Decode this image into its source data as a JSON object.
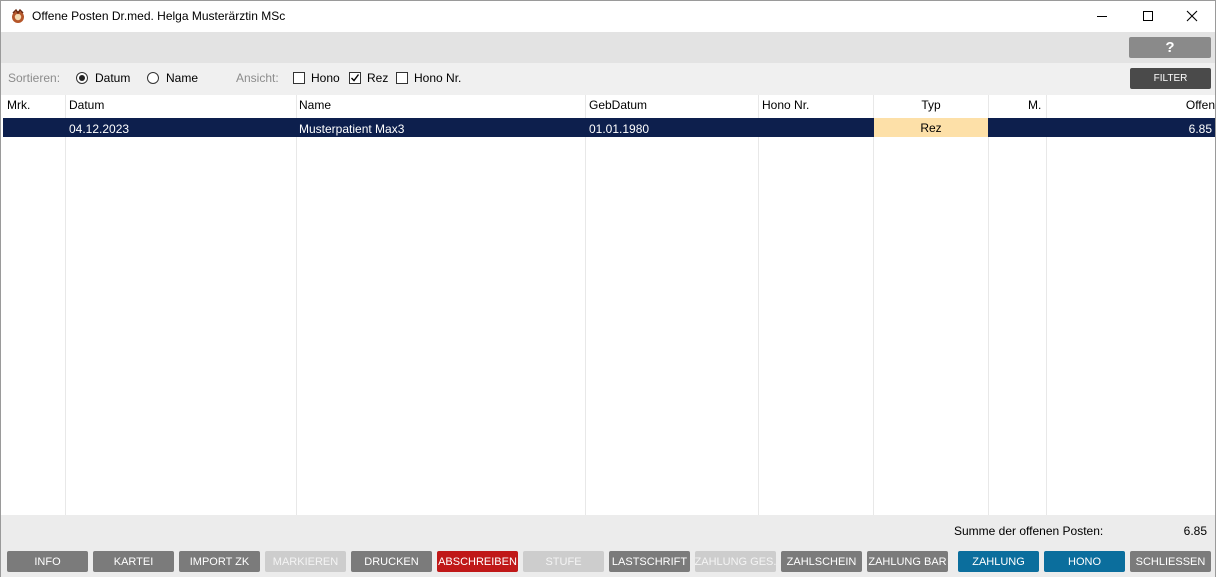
{
  "window": {
    "title": "Offene Posten Dr.med. Helga Musterärztin MSc"
  },
  "icons": {
    "app": "app-logo-icon",
    "minimize": "minimize-icon",
    "maximize": "maximize-icon",
    "close": "close-icon"
  },
  "help": {
    "label": "?"
  },
  "options": {
    "sort_label": "Sortieren:",
    "sort_datum": "Datum",
    "sort_name": "Name",
    "sort_selected": "Datum",
    "view_label": "Ansicht:",
    "view_hono": "Hono",
    "view_rez": "Rez",
    "view_hono_nr": "Hono Nr.",
    "view_checked": [
      "Rez"
    ],
    "filter": "FILTER"
  },
  "table": {
    "columns": [
      "Mrk.",
      "Datum",
      "Name",
      "GebDatum",
      "Hono Nr.",
      "Typ",
      "M.",
      "Offen"
    ],
    "rows": [
      {
        "mrk": "",
        "datum": "04.12.2023",
        "name": "Musterpatient Max3",
        "gebdatum": "01.01.1980",
        "hono_nr": "",
        "typ": "Rez",
        "m": "",
        "offen": "6.85"
      }
    ]
  },
  "summary": {
    "label": "Summe der offenen Posten:",
    "value": "6.85"
  },
  "buttons": {
    "info": "INFO",
    "kartei": "KARTEI",
    "import_zk": "IMPORT ZK",
    "markieren": "MARKIEREN",
    "drucken": "DRUCKEN",
    "abschreiben": "ABSCHREIBEN",
    "stufe": "STUFE",
    "lastschrift": "LASTSCHRIFT",
    "zahlung_ges": "ZAHLUNG GES.",
    "zahlschein": "ZAHLSCHEIN",
    "zahlung_bar": "ZAHLUNG BAR",
    "zahlung": "ZAHLUNG",
    "hono": "HONO",
    "schliessen": "SCHLIESSEN"
  },
  "colors": {
    "selected_row": "#0d1f4d",
    "typ_highlight": "#fde0a8",
    "danger": "#c01818",
    "primary": "#0b6e9d"
  }
}
